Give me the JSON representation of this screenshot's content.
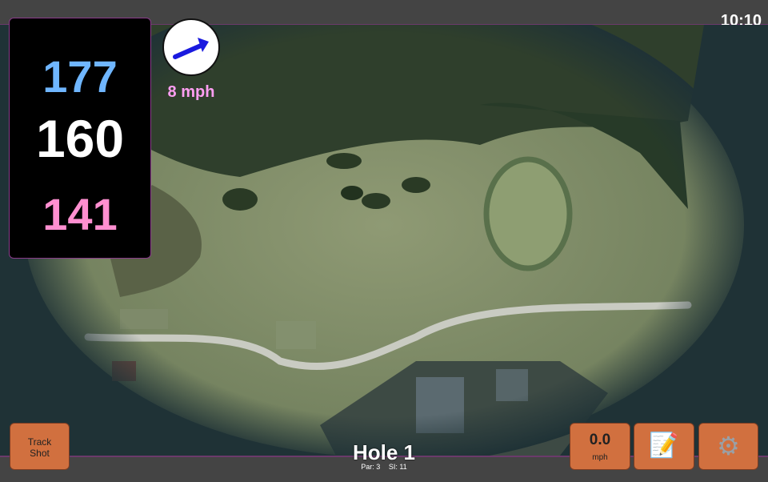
{
  "clock": "10:10",
  "distances": {
    "back": "177",
    "middle": "160",
    "front": "141"
  },
  "wind": {
    "speed": "8 mph",
    "icon": "wind-arrow-icon",
    "arrow_color": "#1a1adf"
  },
  "buttons": {
    "track_shot": "Track\nShot",
    "speed_value": "0.0",
    "speed_unit": "mph",
    "notes_icon": "notepad-icon",
    "settings_icon": "gear-icon"
  },
  "hole": {
    "title": "Hole 1",
    "par": "Par: 3",
    "si": "SI: 11"
  },
  "colors": {
    "back_distance": "#6fb6ff",
    "middle_distance": "#ffffff",
    "front_distance": "#ff8fd0",
    "button": "#d1703f",
    "accent": "#8a3a8a"
  }
}
